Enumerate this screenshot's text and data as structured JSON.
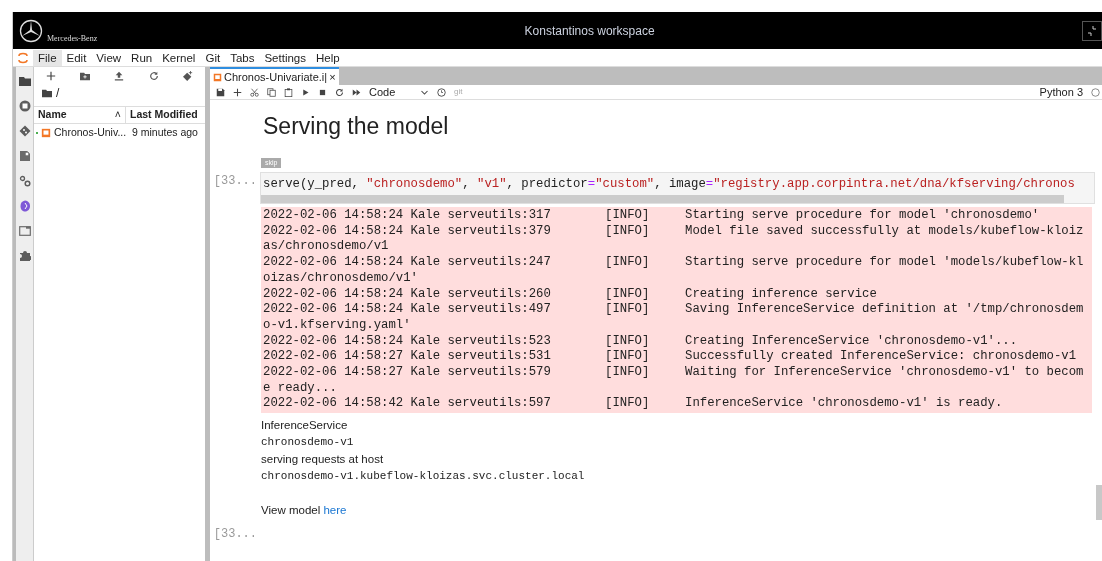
{
  "header": {
    "brand": "Mercedes-Benz",
    "title": "Konstantinos workspace"
  },
  "menu": [
    {
      "label": "File",
      "selected": true
    },
    {
      "label": "Edit",
      "selected": false
    },
    {
      "label": "View",
      "selected": false
    },
    {
      "label": "Run",
      "selected": false
    },
    {
      "label": "Kernel",
      "selected": false
    },
    {
      "label": "Git",
      "selected": false
    },
    {
      "label": "Tabs",
      "selected": false
    },
    {
      "label": "Settings",
      "selected": false
    },
    {
      "label": "Help",
      "selected": false
    }
  ],
  "sidebar": {
    "icons": [
      {
        "kind": "folder",
        "selected": true
      },
      {
        "kind": "stop",
        "selected": false
      },
      {
        "kind": "git",
        "selected": false
      },
      {
        "kind": "inspector",
        "selected": false
      },
      {
        "kind": "gears",
        "selected": false
      },
      {
        "kind": "kubeflow",
        "selected": false
      },
      {
        "kind": "window",
        "selected": false
      },
      {
        "kind": "puzzle",
        "selected": false
      }
    ]
  },
  "file_browser": {
    "path": "/",
    "columns": [
      "Name",
      "Last Modified"
    ],
    "sort_indicator": "˄",
    "files": [
      {
        "name": "Chronos-Univ...",
        "modified": "9 minutes ago",
        "running": true
      }
    ]
  },
  "notebook": {
    "tab": {
      "label": "Chronos-Univariate.i|",
      "close": "×"
    },
    "cell_type": "Code",
    "git_label": "git",
    "kernel": "Python 3",
    "heading": "Serving the model",
    "cell": {
      "tag": "skip",
      "prompt": "[33...",
      "code": [
        {
          "kind": "plain",
          "text": "serve(y_pred, "
        },
        {
          "kind": "string",
          "text": "\"chronosdemo\""
        },
        {
          "kind": "plain",
          "text": ", "
        },
        {
          "kind": "string",
          "text": "\"v1\""
        },
        {
          "kind": "plain",
          "text": ", predictor"
        },
        {
          "kind": "operator",
          "text": "="
        },
        {
          "kind": "string",
          "text": "\"custom\""
        },
        {
          "kind": "plain",
          "text": ", image"
        },
        {
          "kind": "operator",
          "text": "="
        },
        {
          "kind": "string",
          "text": "\"registry.app.corpintra.net/dna/kfserving/chronos"
        }
      ],
      "log": [
        {
          "source": "2022-02-06 14:58:24 Kale serveutils:317",
          "level": "[INFO]",
          "message": "Starting serve procedure for model 'chronosdemo'"
        },
        {
          "source": "2022-02-06 14:58:24 Kale serveutils:379",
          "level": "[INFO]",
          "message": "Model file saved successfully at models/kubeflow-kloiz",
          "continuation": "as/chronosdemo/v1"
        },
        {
          "source": "2022-02-06 14:58:24 Kale serveutils:247",
          "level": "[INFO]",
          "message": "Starting serve procedure for model 'models/kubeflow-kl",
          "continuation": "oizas/chronosdemo/v1'"
        },
        {
          "source": "2022-02-06 14:58:24 Kale serveutils:260",
          "level": "[INFO]",
          "message": "Creating inference service"
        },
        {
          "source": "2022-02-06 14:58:24 Kale serveutils:497",
          "level": "[INFO]",
          "message": "Saving InferenceService definition at '/tmp/chronosdem",
          "continuation": "o-v1.kfserving.yaml'"
        },
        {
          "source": "2022-02-06 14:58:24 Kale serveutils:523",
          "level": "[INFO]",
          "message": "Creating InferenceService 'chronosdemo-v1'..."
        },
        {
          "source": "2022-02-06 14:58:27 Kale serveutils:531",
          "level": "[INFO]",
          "message": "Successfully created InferenceService: chronosdemo-v1"
        },
        {
          "source": "2022-02-06 14:58:27 Kale serveutils:579",
          "level": "[INFO]",
          "message": "Waiting for InferenceService 'chronosdemo-v1' to becom",
          "continuation": "e ready..."
        },
        {
          "source": "2022-02-06 14:58:42 Kale serveutils:597",
          "level": "[INFO]",
          "message": "InferenceService 'chronosdemo-v1' is ready."
        }
      ],
      "result": [
        {
          "kind": "label",
          "text": "InferenceService"
        },
        {
          "kind": "mono",
          "text": "chronosdemo-v1"
        },
        {
          "kind": "label",
          "text": "serving requests at host"
        },
        {
          "kind": "mono",
          "text": "chronosdemo-v1.kubeflow-kloizas.svc.cluster.local"
        }
      ],
      "view_text": "View model ",
      "view_link": "here"
    },
    "next_cell": {
      "prompt": "[33..."
    }
  }
}
